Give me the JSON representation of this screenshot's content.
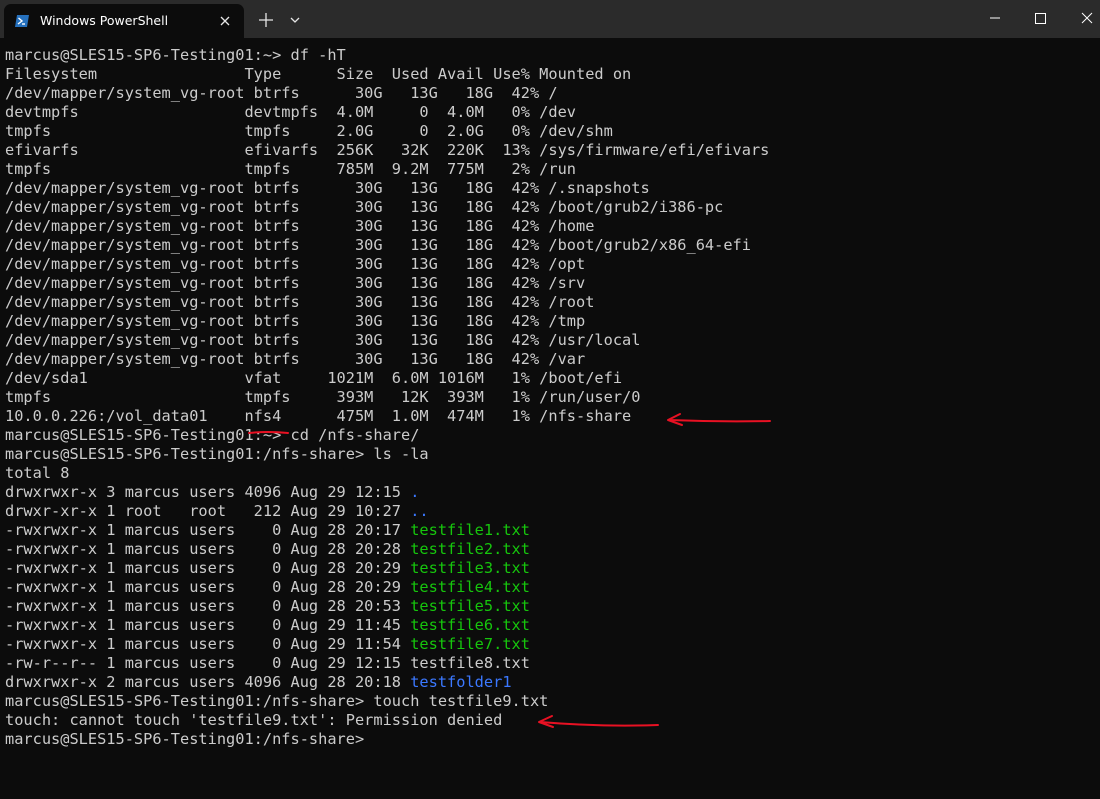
{
  "window": {
    "tab_title": "Windows PowerShell",
    "tab_icon": "powershell-icon",
    "new_tab_icon": "plus-icon",
    "dropdown_icon": "chevron-down-icon",
    "controls": [
      "minimize-icon",
      "maximize-icon",
      "close-icon"
    ]
  },
  "terminal": {
    "colors": {
      "text": "#cccccc",
      "directory": "#3b78ff",
      "executable": "#16c60c",
      "annotation": "#e81123"
    },
    "lines": [
      "marcus@SLES15-SP6-Testing01:~> df -hT",
      "Filesystem                Type      Size  Used Avail Use% Mounted on",
      "/dev/mapper/system_vg-root btrfs      30G   13G   18G  42% /",
      "devtmpfs                  devtmpfs  4.0M     0  4.0M   0% /dev",
      "tmpfs                     tmpfs     2.0G     0  2.0G   0% /dev/shm",
      "efivarfs                  efivarfs  256K   32K  220K  13% /sys/firmware/efi/efivars",
      "tmpfs                     tmpfs     785M  9.2M  775M   2% /run",
      "/dev/mapper/system_vg-root btrfs      30G   13G   18G  42% /.snapshots",
      "/dev/mapper/system_vg-root btrfs      30G   13G   18G  42% /boot/grub2/i386-pc",
      "/dev/mapper/system_vg-root btrfs      30G   13G   18G  42% /home",
      "/dev/mapper/system_vg-root btrfs      30G   13G   18G  42% /boot/grub2/x86_64-efi",
      "/dev/mapper/system_vg-root btrfs      30G   13G   18G  42% /opt",
      "/dev/mapper/system_vg-root btrfs      30G   13G   18G  42% /srv",
      "/dev/mapper/system_vg-root btrfs      30G   13G   18G  42% /root",
      "/dev/mapper/system_vg-root btrfs      30G   13G   18G  42% /tmp",
      "/dev/mapper/system_vg-root btrfs      30G   13G   18G  42% /usr/local",
      "/dev/mapper/system_vg-root btrfs      30G   13G   18G  42% /var",
      "/dev/sda1                 vfat     1021M  6.0M 1016M   1% /boot/efi",
      "tmpfs                     tmpfs     393M   12K  393M   1% /run/user/0",
      "10.0.0.226:/vol_data01    nfs4      475M  1.0M  474M   1% /nfs-share",
      "marcus@SLES15-SP6-Testing01:~> cd /nfs-share/",
      "marcus@SLES15-SP6-Testing01:/nfs-share> ls -la",
      "total 8",
      [
        {
          "t": "drwxrwxr-x 3 marcus users 4096 Aug 29 12:15 "
        },
        {
          "t": ".",
          "c": "blue"
        }
      ],
      [
        {
          "t": "drwxr-xr-x 1 root   root   212 Aug 29 10:27 "
        },
        {
          "t": "..",
          "c": "blue"
        }
      ],
      [
        {
          "t": "-rwxrwxr-x 1 marcus users    0 Aug 28 20:17 "
        },
        {
          "t": "testfile1.txt",
          "c": "green"
        }
      ],
      [
        {
          "t": "-rwxrwxr-x 1 marcus users    0 Aug 28 20:28 "
        },
        {
          "t": "testfile2.txt",
          "c": "green"
        }
      ],
      [
        {
          "t": "-rwxrwxr-x 1 marcus users    0 Aug 28 20:29 "
        },
        {
          "t": "testfile3.txt",
          "c": "green"
        }
      ],
      [
        {
          "t": "-rwxrwxr-x 1 marcus users    0 Aug 28 20:29 "
        },
        {
          "t": "testfile4.txt",
          "c": "green"
        }
      ],
      [
        {
          "t": "-rwxrwxr-x 1 marcus users    0 Aug 28 20:53 "
        },
        {
          "t": "testfile5.txt",
          "c": "green"
        }
      ],
      [
        {
          "t": "-rwxrwxr-x 1 marcus users    0 Aug 29 11:45 "
        },
        {
          "t": "testfile6.txt",
          "c": "green"
        }
      ],
      [
        {
          "t": "-rwxrwxr-x 1 marcus users    0 Aug 29 11:54 "
        },
        {
          "t": "testfile7.txt",
          "c": "green"
        }
      ],
      "-rw-r--r-- 1 marcus users    0 Aug 29 12:15 testfile8.txt",
      [
        {
          "t": "drwxrwxr-x 2 marcus users 4096 Aug 28 20:18 "
        },
        {
          "t": "testfolder1",
          "c": "blue"
        }
      ],
      "marcus@SLES15-SP6-Testing01:/nfs-share> touch testfile9.txt",
      "touch: cannot touch 'testfile9.txt': Permission denied",
      "marcus@SLES15-SP6-Testing01:/nfs-share> "
    ]
  }
}
